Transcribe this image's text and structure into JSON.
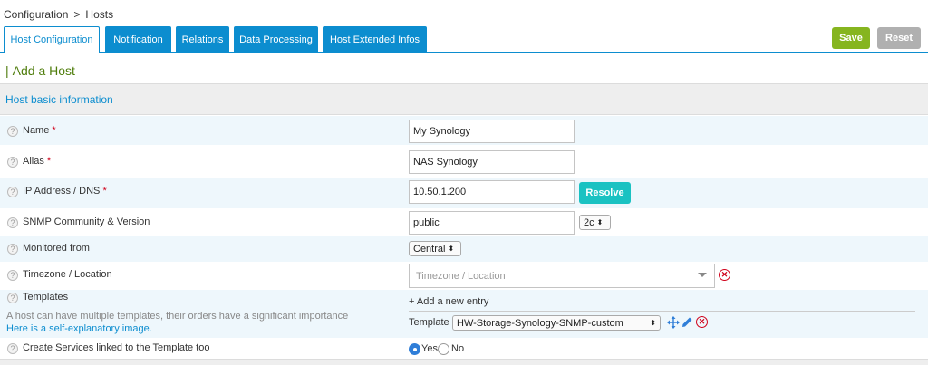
{
  "breadcrumb": {
    "root": "Configuration",
    "separator": ">",
    "current": "Hosts"
  },
  "tabs": [
    {
      "label": "Host Configuration",
      "active": true
    },
    {
      "label": "Notification"
    },
    {
      "label": "Relations"
    },
    {
      "label": "Data Processing"
    },
    {
      "label": "Host Extended Infos"
    }
  ],
  "actions": {
    "save_label": "Save",
    "reset_label": "Reset"
  },
  "page_title": {
    "bar": "|",
    "text": "Add a Host"
  },
  "section": {
    "title": "Host basic information"
  },
  "fields": {
    "name": {
      "label": "Name",
      "required": "*",
      "value": "My Synology"
    },
    "alias": {
      "label": "Alias",
      "required": "*",
      "value": "NAS Synology"
    },
    "ip": {
      "label": "IP Address / DNS",
      "required": "*",
      "value": "10.50.1.200",
      "resolve_label": "Resolve"
    },
    "snmp": {
      "label": "SNMP Community & Version",
      "community": "public",
      "version": "2c"
    },
    "monitored": {
      "label": "Monitored from",
      "value": "Central"
    },
    "timezone": {
      "label": "Timezone / Location",
      "placeholder": "Timezone / Location"
    },
    "templates": {
      "label": "Templates",
      "hint": "A host can have multiple templates, their orders have a significant importance",
      "hint_link": "Here is a self-explanatory image.",
      "add_entry": "+ Add a new entry",
      "template_label": "Template",
      "template_value": "HW-Storage-Synology-SNMP-custom"
    },
    "services": {
      "label": "Create Services linked to the Template too",
      "yes": "Yes",
      "no": "No",
      "selected": "Yes"
    }
  },
  "icons": {
    "help": "help-icon",
    "remove": "remove-circle-icon",
    "move": "move-arrows-icon",
    "edit": "pencil-icon"
  },
  "colors": {
    "accent": "#0c8dcf",
    "save": "#86b51f",
    "reset": "#b0b0b0",
    "resolve": "#1ac2c2",
    "required": "#d0021b",
    "title": "#4f7d0c"
  }
}
